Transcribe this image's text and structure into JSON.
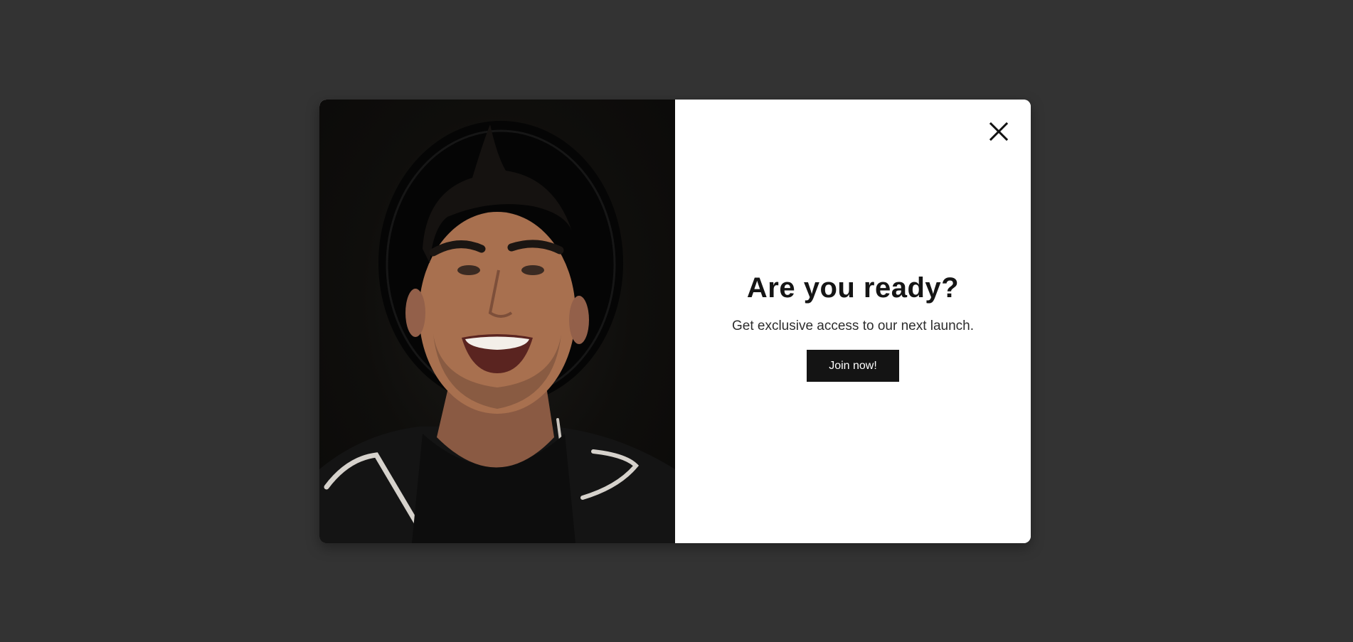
{
  "popup": {
    "headline": "Are you ready?",
    "subtext": "Get exclusive access to our next launch.",
    "cta_label": "Join now!",
    "close_icon": "close-icon",
    "image_alt": "Smiling man wearing a black hat and hoodie"
  },
  "colors": {
    "backdrop": "#333333",
    "modal_bg": "#ffffff",
    "headline": "#151515",
    "button_bg": "#141414",
    "button_text": "#ffffff"
  }
}
